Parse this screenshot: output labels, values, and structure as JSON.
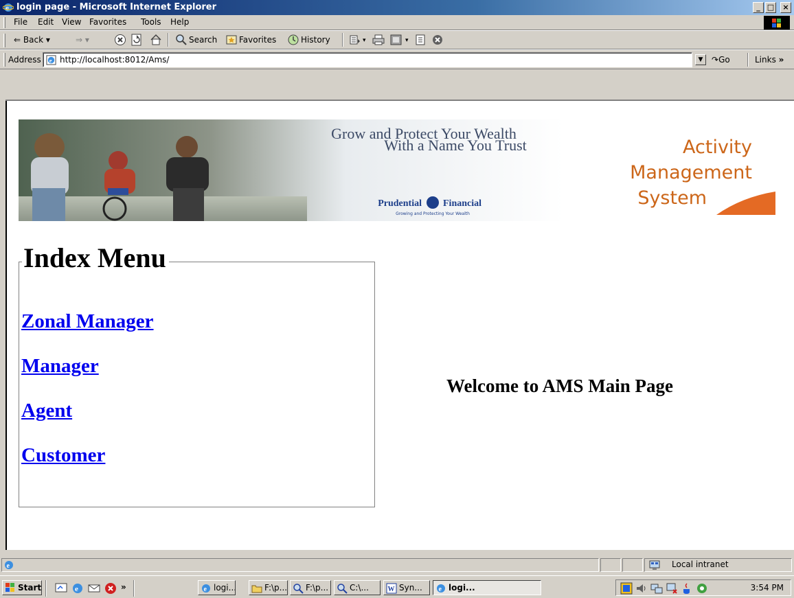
{
  "window": {
    "title": "login page - Microsoft Internet Explorer"
  },
  "menubar": {
    "items": [
      "File",
      "Edit",
      "View",
      "Favorites",
      "Tools",
      "Help"
    ]
  },
  "toolbar": {
    "back": "Back",
    "search": "Search",
    "favorites": "Favorites",
    "history": "History"
  },
  "address": {
    "label": "Address",
    "url": "http://localhost:8012/Ams/",
    "go": "Go",
    "links": "Links"
  },
  "banner": {
    "headline1": "Grow and Protect Your Wealth",
    "headline2": "With a Name You Trust",
    "brand": "Prudential",
    "brand2": "Financial",
    "tagline": "Growing and Protecting Your Wealth"
  },
  "logo": {
    "line1": "Activity",
    "line2": "Management",
    "line3": "System"
  },
  "menu": {
    "legend": "Index Menu",
    "links": [
      "Zonal Manager",
      "Manager",
      "Agent",
      "Customer"
    ]
  },
  "welcome": "Welcome to AMS Main Page",
  "status": {
    "zone": "Local intranet"
  },
  "taskbar": {
    "start": "Start",
    "tasks": [
      "logi...",
      "F:\\p...",
      "F:\\p...",
      "C:\\...",
      "Syn...",
      "logi..."
    ],
    "clock": "3:54 PM"
  },
  "colors": {
    "title_bar": "#0a246a",
    "link": "#0000ee",
    "logo": "#cc6619"
  }
}
